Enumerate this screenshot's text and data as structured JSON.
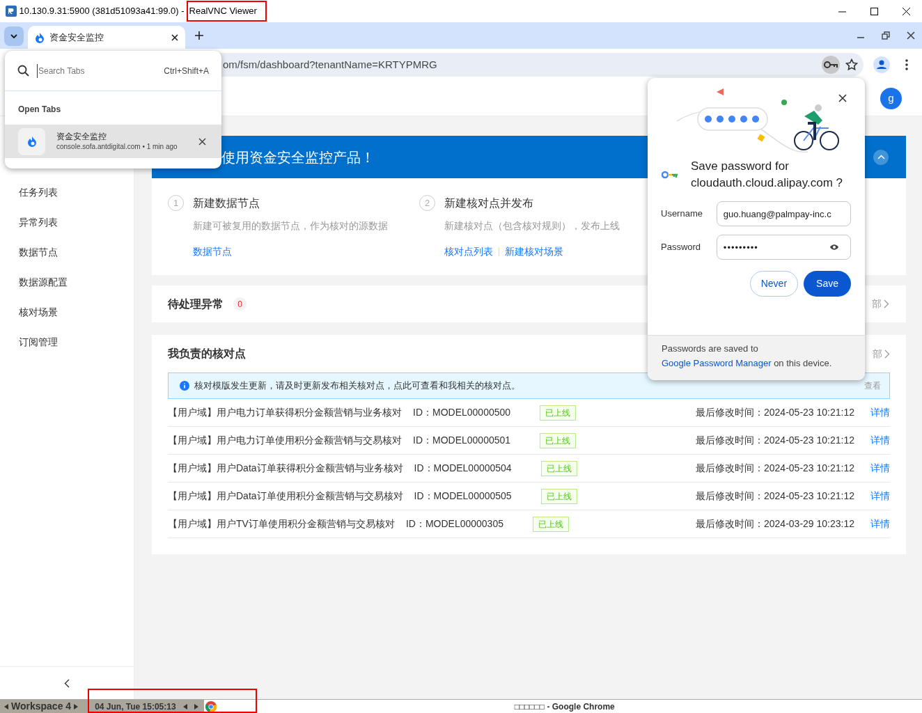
{
  "vnc_window": {
    "title": "10.130.9.31:5900 (381d51093a41:99.0) -",
    "app_name": "RealVNC Viewer"
  },
  "browser": {
    "tabs": [
      {
        "label": "资金安全监控",
        "selected": true
      }
    ],
    "address": "om/fsm/dashboard?tenantName=KRTYPMRG"
  },
  "tab_search": {
    "placeholder": "Search Tabs",
    "shortcut": "Ctrl+Shift+A",
    "section": "Open Tabs",
    "results": [
      {
        "title": "资金安全监控",
        "subtitle": "console.sofa.antdigital.com • 1 min ago",
        "selected": true
      }
    ]
  },
  "page": {
    "avatar": "g",
    "sidebar": {
      "items": [
        "任务列表",
        "异常列表",
        "数据节点",
        "数据源配置",
        "核对场景",
        "订阅管理"
      ]
    },
    "banner": "使用资金安全监控产品！",
    "steps": [
      {
        "number": "1",
        "title": "新建数据节点",
        "description": "新建可被复用的数据节点，作为核对的源数据",
        "links": [
          "数据节点"
        ]
      },
      {
        "number": "2",
        "title": "新建核对点并发布",
        "description": "新建核对点（包含核对规则），发布上线",
        "links": [
          "核对点列表",
          "新建核对场景"
        ]
      }
    ],
    "pending": {
      "title": "待处理异常",
      "count": "0",
      "more": "部"
    },
    "responsible": {
      "title": "我负责的核对点",
      "more": "部",
      "notice": "核对模版发生更新，请及时更新发布相关核对点，点此可查看和我相关的核对点。",
      "notice_action": "查看",
      "rows": [
        {
          "name": "【用户域】用户电力订单获得积分金额营销与业务核对",
          "id": "ID：MODEL00000500",
          "status": "已上线",
          "modified": "最后修改时间：2024-05-23 10:21:12",
          "action": "详情"
        },
        {
          "name": "【用户域】用户电力订单使用积分金额营销与交易核对",
          "id": "ID：MODEL00000501",
          "status": "已上线",
          "modified": "最后修改时间：2024-05-23 10:21:12",
          "action": "详情"
        },
        {
          "name": "【用户域】用户Data订单获得积分金额营销与业务核对",
          "id": "ID：MODEL00000504",
          "status": "已上线",
          "modified": "最后修改时间：2024-05-23 10:21:12",
          "action": "详情"
        },
        {
          "name": "【用户域】用户Data订单使用积分金额营销与交易核对",
          "id": "ID：MODEL00000505",
          "status": "已上线",
          "modified": "最后修改时间：2024-05-23 10:21:12",
          "action": "详情"
        },
        {
          "name": "【用户域】用户TV订单使用积分金额营销与交易核对",
          "id": "ID：MODEL00000305",
          "status": "已上线",
          "modified": "最后修改时间：2024-03-29 10:23:12",
          "action": "详情"
        }
      ]
    }
  },
  "password_bubble": {
    "heading": "Save password for cloudauth.cloud.alipay.com ?",
    "username_label": "Username",
    "username": "guo.huang@palmpay-inc.c",
    "password_label": "Password",
    "password": "•••••••••",
    "buttons": [
      "Never",
      "Save"
    ],
    "footer_before": "Passwords are saved to",
    "footer_link": "Google Password Manager",
    "footer_after": "on this device."
  },
  "taskbar": {
    "workspace": "Workspace 4",
    "clock": "04 Jun, Tue 15:05:13",
    "window_title": "□□□□□□ - Google Chrome"
  }
}
